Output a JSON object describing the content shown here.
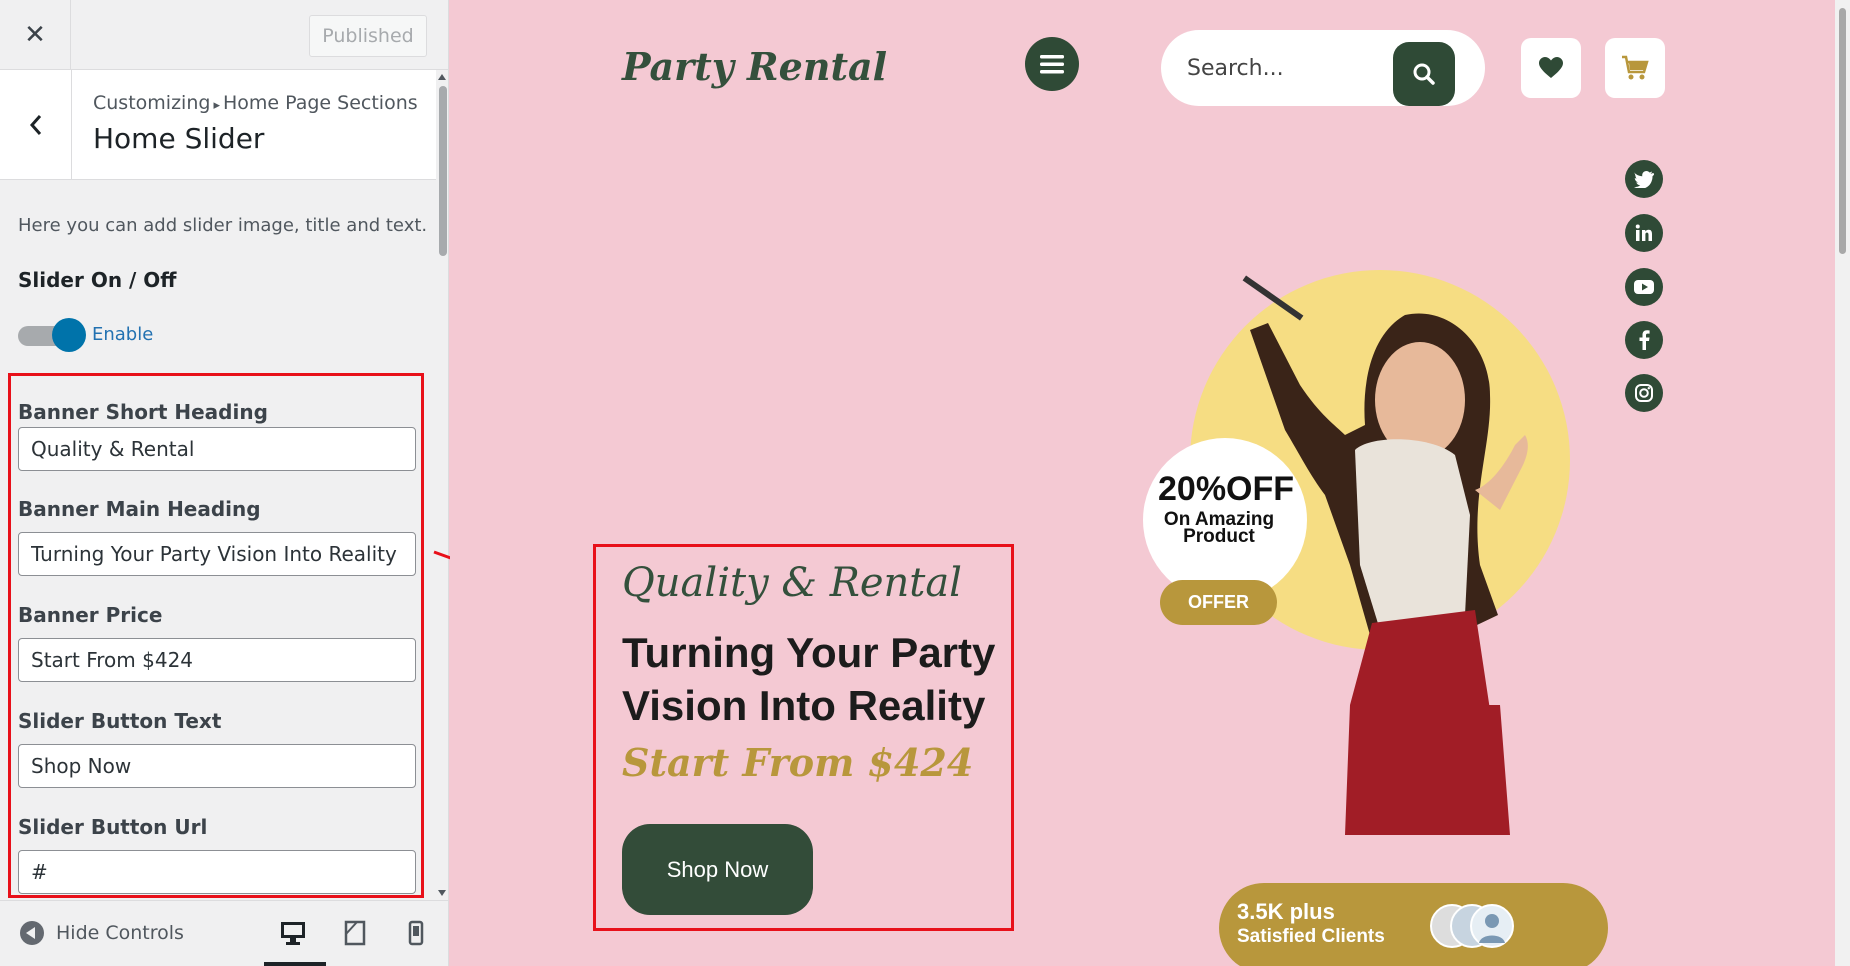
{
  "sidebar": {
    "publish_label": "Published",
    "breadcrumb_root": "Customizing",
    "breadcrumb_sep": "▸",
    "breadcrumb_parent": "Home Page Sections",
    "section_title": "Home Slider",
    "description": "Here you can add slider image, title and text.",
    "toggle": {
      "label": "Slider On / Off",
      "state_text": "Enable",
      "enabled": true
    },
    "fields": [
      {
        "label": "Banner Short Heading",
        "value": "Quality & Rental"
      },
      {
        "label": "Banner Main Heading",
        "value": "Turning Your Party Vision Into Reality"
      },
      {
        "label": "Banner Price",
        "value": "Start From $424"
      },
      {
        "label": "Slider Button Text",
        "value": "Shop Now"
      },
      {
        "label": "Slider Button Url",
        "value": "#"
      }
    ],
    "footer": {
      "hide_label": "Hide Controls",
      "active_device": "desktop"
    }
  },
  "preview": {
    "logo": "Party Rental",
    "search": {
      "placeholder": "Search..."
    },
    "social": [
      "twitter-icon",
      "linkedin-icon",
      "youtube-icon",
      "facebook-icon",
      "instagram-icon"
    ],
    "offer": {
      "percent": "20%OFF",
      "line2": "On Amazing Product",
      "button": "OFFER"
    },
    "hero": {
      "short_heading": "Quality & Rental",
      "main_heading": "Turning Your Party Vision Into Reality",
      "price": "Start From $424",
      "button": "Shop Now"
    },
    "clients": {
      "count": "3.5K plus",
      "label": "Satisfied Clients"
    }
  },
  "colors": {
    "brand_green": "#2f4a36",
    "gold": "#b8973c",
    "pink_bg": "#f4c9d3",
    "annotation_red": "#e8101a",
    "wp_blue": "#0073aa"
  }
}
